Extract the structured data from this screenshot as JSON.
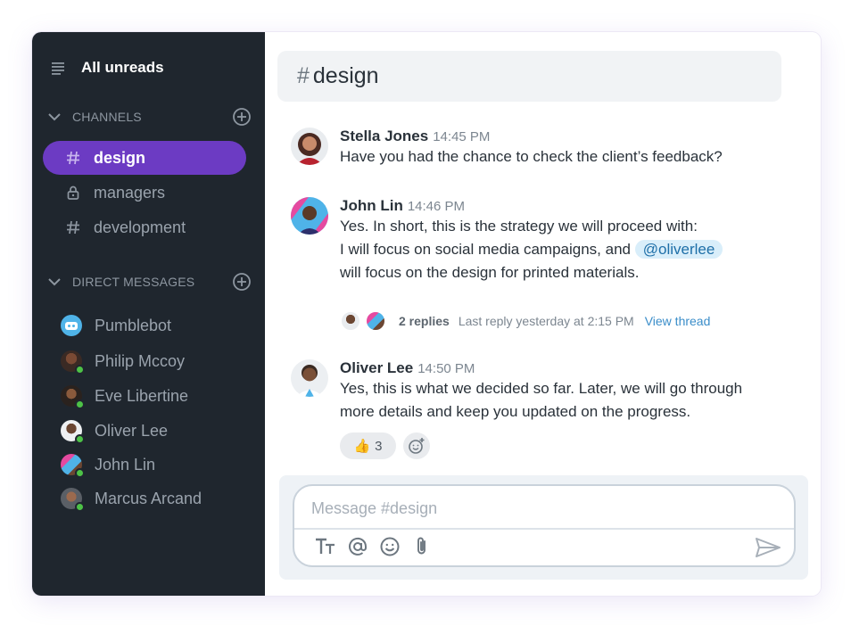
{
  "sidebar": {
    "all_unreads": "All unreads",
    "channels_header": "CHANNELS",
    "direct_messages_header": "DIRECT MESSAGES",
    "channels": [
      {
        "label": "design",
        "icon": "hash-icon",
        "active": true
      },
      {
        "label": "managers",
        "icon": "lock-icon",
        "active": false
      },
      {
        "label": "development",
        "icon": "hash-icon",
        "active": false
      }
    ],
    "direct_messages": [
      {
        "label": "Pumblebot"
      },
      {
        "label": "Philip Mccoy"
      },
      {
        "label": "Eve Libertine"
      },
      {
        "label": "Oliver Lee"
      },
      {
        "label": "John Lin"
      },
      {
        "label": "Marcus Arcand"
      }
    ]
  },
  "channel": {
    "hash": "#",
    "name": "design"
  },
  "messages": [
    {
      "author": "Stella Jones",
      "time": "14:45 PM",
      "lines": [
        "Have you had the chance to check the client’s feedback?"
      ]
    },
    {
      "author": "John Lin",
      "time": "14:46 PM",
      "line1": "Yes. In short, this is the strategy we will proceed with:",
      "line2_prefix": "I will focus on social media campaigns, and",
      "mention": "@oliverlee",
      "line3": "will focus on the design for printed materials."
    },
    {
      "author": "Oliver Lee",
      "time": "14:50 PM",
      "lines": [
        "Yes, this is what we decided so far. Later, we will go through",
        "more details and keep you updated on the progress."
      ]
    }
  ],
  "thread": {
    "replies": "2 replies",
    "last_reply": "Last reply yesterday at 2:15 PM",
    "view": "View thread"
  },
  "reaction": {
    "emoji": "👍",
    "count": "3"
  },
  "composer": {
    "placeholder": "Message #design",
    "value": ""
  },
  "colors": {
    "sidebar_bg": "#1f262e",
    "active_channel": "#6c3bc3",
    "online": "#4dc247",
    "link": "#3a8dc9",
    "mention_bg": "#d9eefa"
  }
}
